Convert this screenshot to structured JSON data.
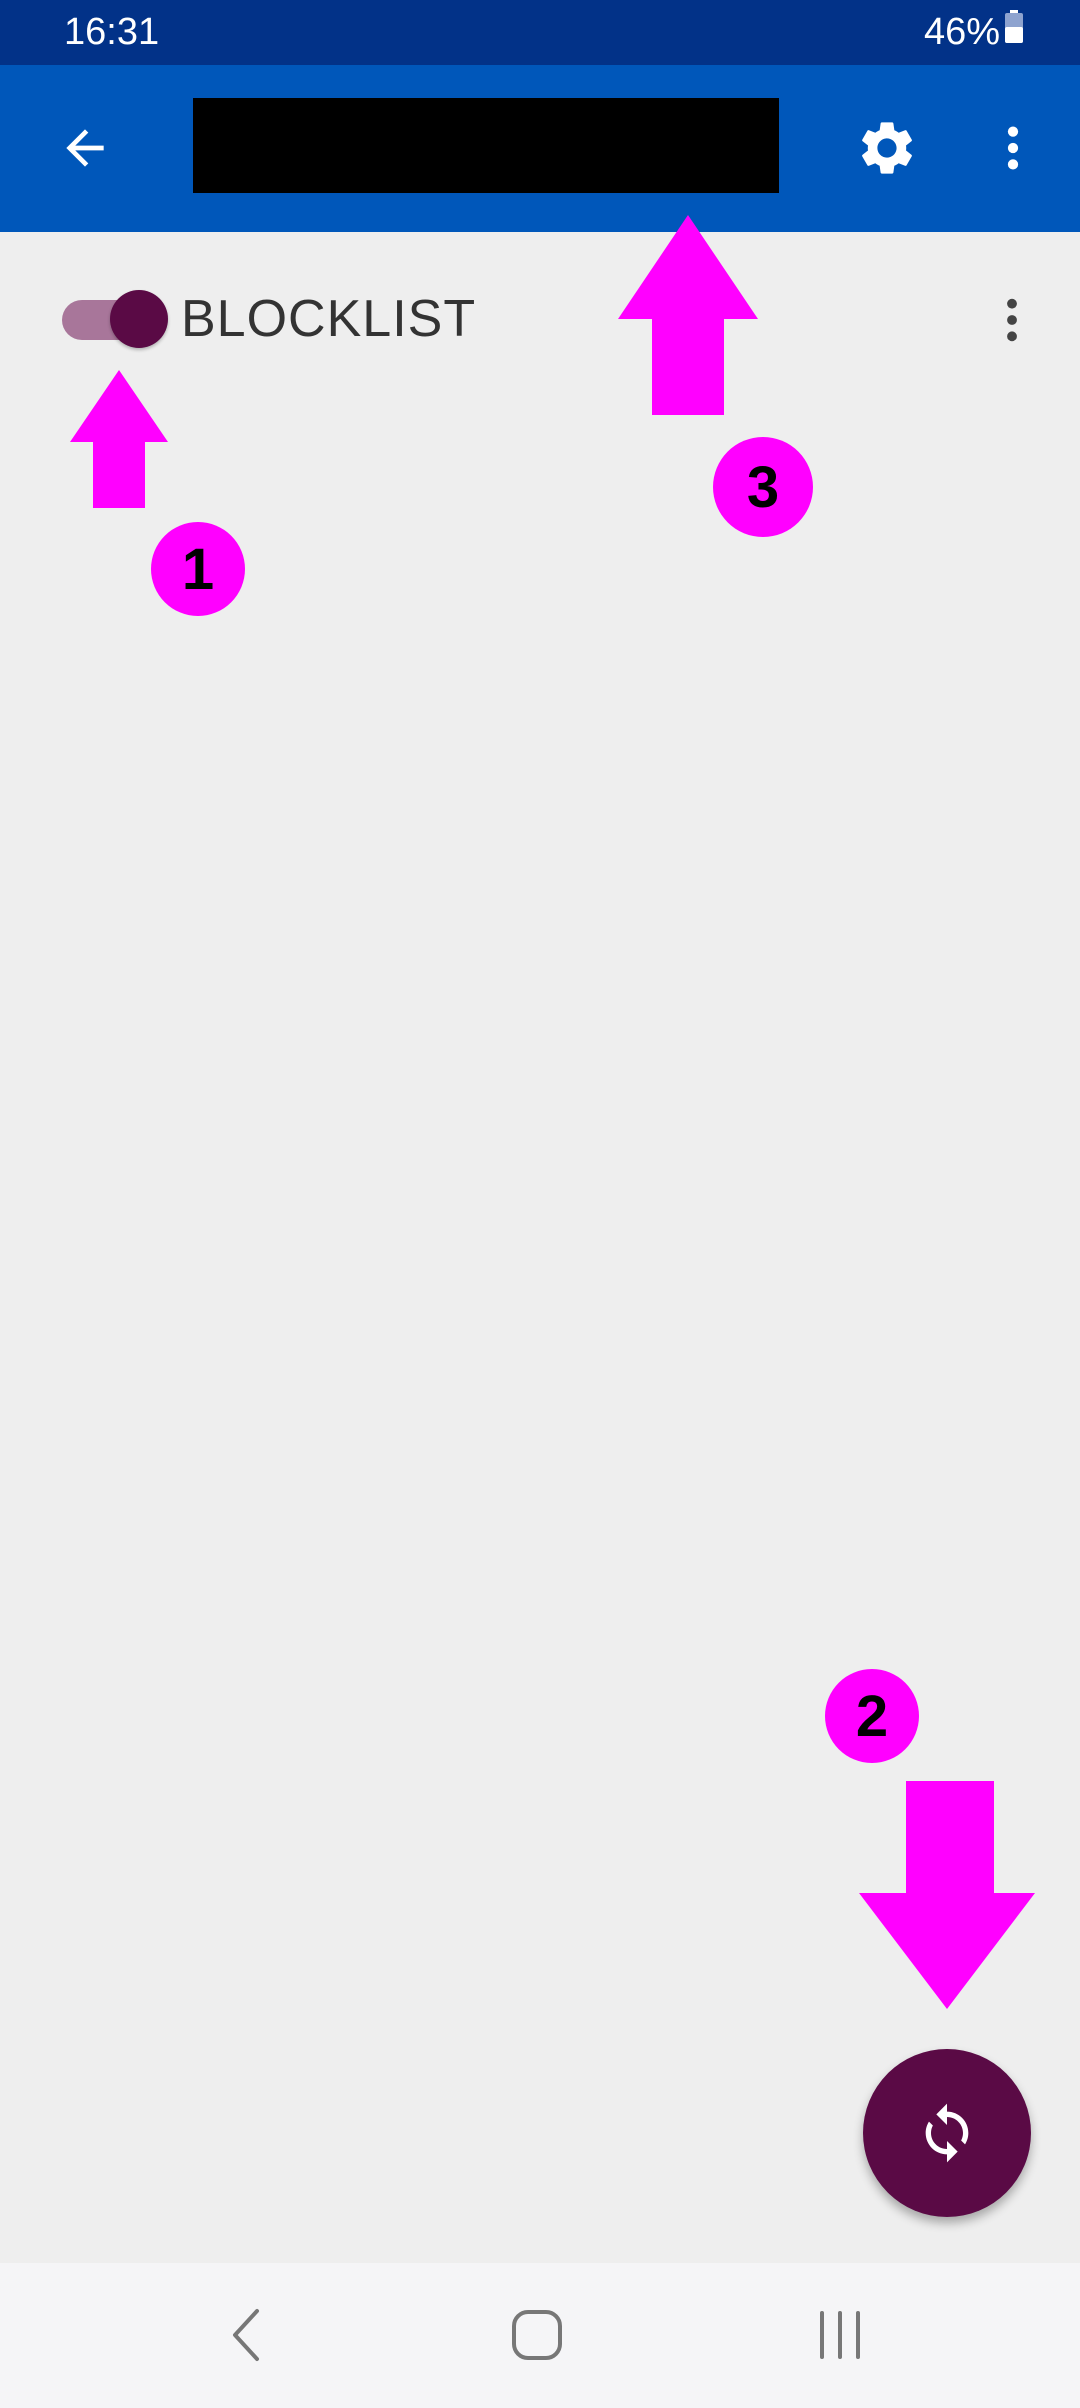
{
  "status_bar": {
    "time": "16:31",
    "battery": "46%",
    "background": "#023288"
  },
  "app_bar": {
    "title": "",
    "title_redacted": true,
    "background": "#0057BA",
    "icons": [
      "back-arrow-icon",
      "gear-icon",
      "more-vertical-icon"
    ]
  },
  "list": {
    "items": [
      {
        "label": "BLOCKLIST",
        "enabled": true
      }
    ]
  },
  "fab": {
    "icon": "sync-icon",
    "color": "#5A0A45"
  },
  "annotations": {
    "color": "#FF00FF",
    "markers": [
      {
        "label": "1",
        "arrow": "up",
        "points_to": "toggle"
      },
      {
        "label": "2",
        "arrow": "down",
        "points_to": "sync-button"
      },
      {
        "label": "3",
        "arrow": "up",
        "points_to": "app-title"
      }
    ]
  },
  "nav_bar": {
    "icons": [
      "nav-back-icon",
      "nav-home-icon",
      "nav-recents-icon"
    ]
  }
}
